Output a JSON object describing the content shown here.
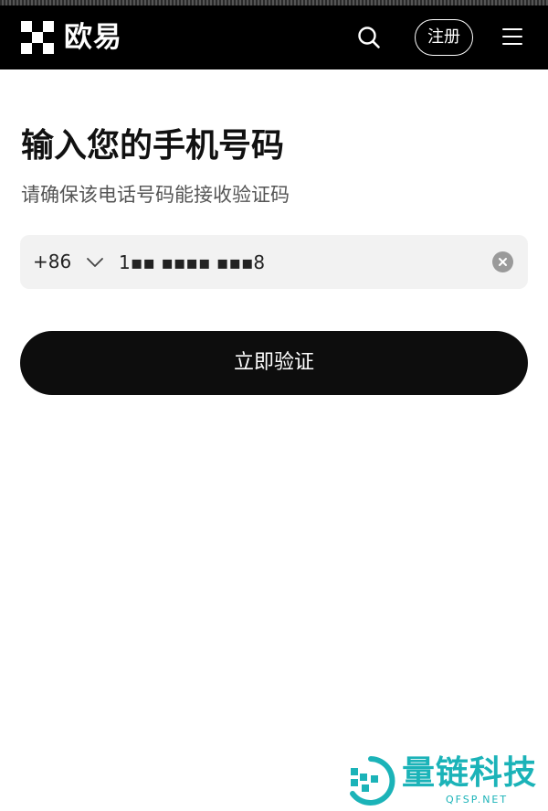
{
  "header": {
    "brand": "欧易",
    "register_label": "注册"
  },
  "main": {
    "title": "输入您的手机号码",
    "subtitle": "请确保该电话号码能接收验证码",
    "phone": {
      "country_code": "+86",
      "value": "1▪▪ ▪▪▪▪ ▪▪▪8"
    },
    "verify_label": "立即验证"
  },
  "watermark": {
    "name": "量链科技",
    "domain": "QFSP.NET"
  },
  "icons": {
    "logo": "okx-logo-icon",
    "search": "search-icon",
    "menu": "hamburger-menu-icon",
    "dropdown": "chevron-down-icon",
    "clear": "clear-circle-icon"
  },
  "colors": {
    "header_bg": "#000000",
    "button_bg": "#0d0d0d",
    "field_bg": "#f2f2f2",
    "watermark": "#1bb3b8"
  }
}
